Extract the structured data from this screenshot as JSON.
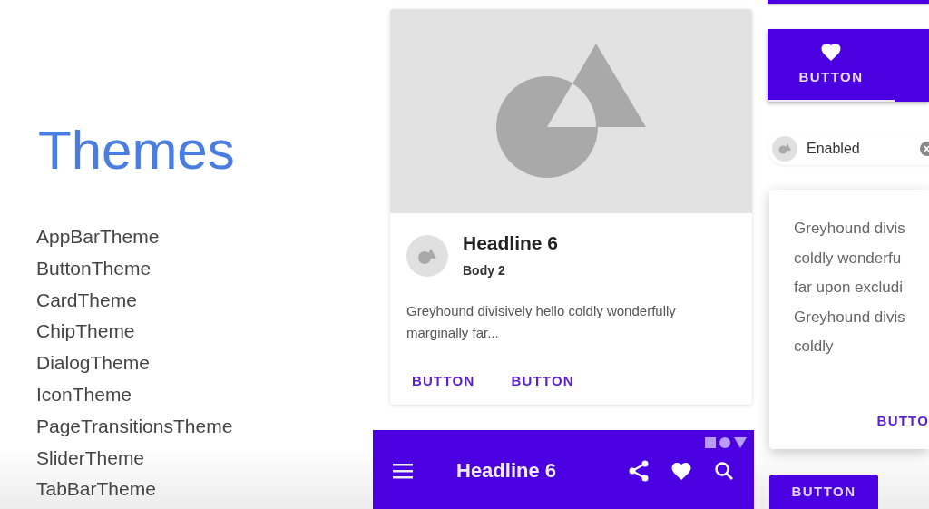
{
  "title": "Themes",
  "theme_list": [
    "AppBarTheme",
    "ButtonTheme",
    "CardTheme",
    "ChipTheme",
    "DialogTheme",
    "IconTheme",
    "PageTransitionsTheme",
    "SliderTheme",
    "TabBarTheme"
  ],
  "media_card": {
    "headline": "Headline 6",
    "subtitle": "Body 2",
    "text": "Greyhound divisively hello coldly wonderfully marginally far...",
    "actions": [
      "BUTTON",
      "BUTTON"
    ]
  },
  "app_bar": {
    "title": "Headline 6"
  },
  "tab_bar": {
    "tabs": [
      {
        "label": "BUTTON",
        "selected": true
      }
    ]
  },
  "chip": {
    "label": "Enabled"
  },
  "dialog": {
    "lines": [
      "Greyhound divis",
      "coldly wonderfu",
      "far upon excludi",
      "Greyhound divis",
      "coldly"
    ],
    "action": "BUTTO"
  },
  "button": {
    "label": "BUTTON"
  }
}
